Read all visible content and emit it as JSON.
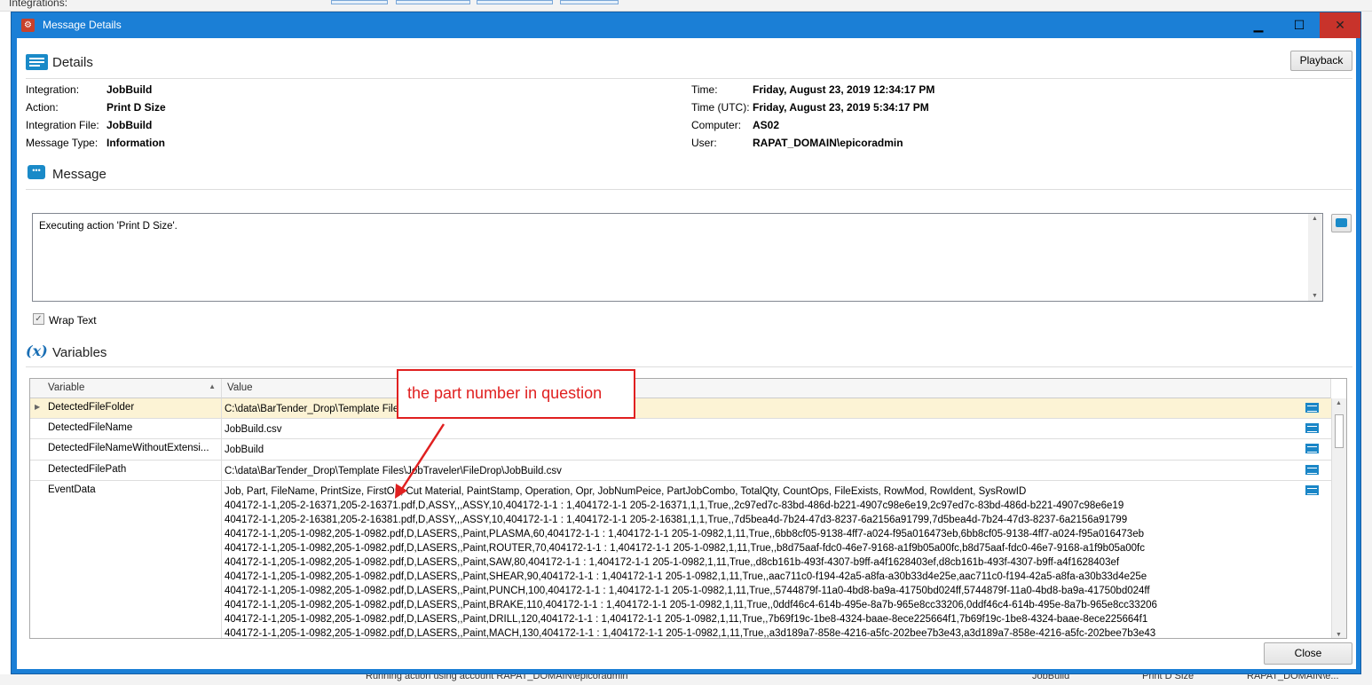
{
  "background": {
    "top_label": "Integrations:",
    "bottom_text": "Running action using account RAPAT_DOMAIN\\epicoradmin",
    "bottom_col2": "JobBuild",
    "bottom_col3": "Print D Size",
    "bottom_col4": "RAPAT_DOMAIN\\e..."
  },
  "window": {
    "title": "Message Details",
    "minimize": "▁",
    "maximize": "☐",
    "close": "✕"
  },
  "details": {
    "heading": "Details",
    "playback": "Playback",
    "left": [
      {
        "label": "Integration:",
        "value": "JobBuild"
      },
      {
        "label": "Action:",
        "value": "Print D Size"
      },
      {
        "label": "Integration File:",
        "value": "JobBuild"
      },
      {
        "label": "Message Type:",
        "value": "Information"
      }
    ],
    "right": [
      {
        "label": "Time:",
        "value": "Friday, August 23, 2019 12:34:17 PM"
      },
      {
        "label": "Time (UTC):",
        "value": "Friday, August 23, 2019 5:34:17 PM"
      },
      {
        "label": "Computer:",
        "value": "AS02"
      },
      {
        "label": "User:",
        "value": "RAPAT_DOMAIN\\epicoradmin"
      }
    ]
  },
  "message": {
    "heading": "Message",
    "text": "Executing action 'Print D Size'.",
    "wrap_text": "Wrap Text",
    "wrap_checked": true
  },
  "variables": {
    "heading": "Variables",
    "col_variable": "Variable",
    "col_value": "Value",
    "rows": [
      {
        "name": "DetectedFileFolder",
        "value": "C:\\data\\BarTender_Drop\\Template Files\\JobTraveler\\FileDrop"
      },
      {
        "name": "DetectedFileName",
        "value": "JobBuild.csv"
      },
      {
        "name": "DetectedFileNameWithoutExtensi...",
        "value": "JobBuild"
      },
      {
        "name": "DetectedFilePath",
        "value": "C:\\data\\BarTender_Drop\\Template Files\\JobTraveler\\FileDrop\\JobBuild.csv"
      }
    ],
    "event_name": "EventData",
    "event_lines": [
      "Job, Part, FileName, PrintSize, FirstOp, Cut Material, PaintStamp, Operation, Opr, JobNumPeice, PartJobCombo, TotalQty, CountOps, FileExists, RowMod, RowIdent, SysRowID",
      "404172-1-1,205-2-16371,205-2-16371.pdf,D,ASSY,,,ASSY,10,404172-1-1 : 1,404172-1-1 205-2-16371,1,1,True,,2c97ed7c-83bd-486d-b221-4907c98e6e19,2c97ed7c-83bd-486d-b221-4907c98e6e19",
      "404172-1-1,205-2-16381,205-2-16381.pdf,D,ASSY,,,ASSY,10,404172-1-1 : 1,404172-1-1 205-2-16381,1,1,True,,7d5bea4d-7b24-47d3-8237-6a2156a91799,7d5bea4d-7b24-47d3-8237-6a2156a91799",
      "404172-1-1,205-1-0982,205-1-0982.pdf,D,LASERS,,Paint,PLASMA,60,404172-1-1 : 1,404172-1-1 205-1-0982,1,11,True,,6bb8cf05-9138-4ff7-a024-f95a016473eb,6bb8cf05-9138-4ff7-a024-f95a016473eb",
      "404172-1-1,205-1-0982,205-1-0982.pdf,D,LASERS,,Paint,ROUTER,70,404172-1-1 : 1,404172-1-1 205-1-0982,1,11,True,,b8d75aaf-fdc0-46e7-9168-a1f9b05a00fc,b8d75aaf-fdc0-46e7-9168-a1f9b05a00fc",
      "404172-1-1,205-1-0982,205-1-0982.pdf,D,LASERS,,Paint,SAW,80,404172-1-1 : 1,404172-1-1 205-1-0982,1,11,True,,d8cb161b-493f-4307-b9ff-a4f1628403ef,d8cb161b-493f-4307-b9ff-a4f1628403ef",
      "404172-1-1,205-1-0982,205-1-0982.pdf,D,LASERS,,Paint,SHEAR,90,404172-1-1 : 1,404172-1-1 205-1-0982,1,11,True,,aac711c0-f194-42a5-a8fa-a30b33d4e25e,aac711c0-f194-42a5-a8fa-a30b33d4e25e",
      "404172-1-1,205-1-0982,205-1-0982.pdf,D,LASERS,,Paint,PUNCH,100,404172-1-1 : 1,404172-1-1 205-1-0982,1,11,True,,5744879f-11a0-4bd8-ba9a-41750bd024ff,5744879f-11a0-4bd8-ba9a-41750bd024ff",
      "404172-1-1,205-1-0982,205-1-0982.pdf,D,LASERS,,Paint,BRAKE,110,404172-1-1 : 1,404172-1-1 205-1-0982,1,11,True,,0ddf46c4-614b-495e-8a7b-965e8cc33206,0ddf46c4-614b-495e-8a7b-965e8cc33206",
      "404172-1-1,205-1-0982,205-1-0982.pdf,D,LASERS,,Paint,DRILL,120,404172-1-1 : 1,404172-1-1 205-1-0982,1,11,True,,7b69f19c-1be8-4324-baae-8ece225664f1,7b69f19c-1be8-4324-baae-8ece225664f1",
      "404172-1-1,205-1-0982,205-1-0982.pdf,D,LASERS,,Paint,MACH,130,404172-1-1 : 1,404172-1-1 205-1-0982,1,11,True,,a3d189a7-858e-4216-a5fc-202bee7b3e43,a3d189a7-858e-4216-a5fc-202bee7b3e43"
    ]
  },
  "annotation": {
    "text": "the part number in question",
    "color": "#e02020"
  },
  "footer": {
    "close": "Close"
  }
}
